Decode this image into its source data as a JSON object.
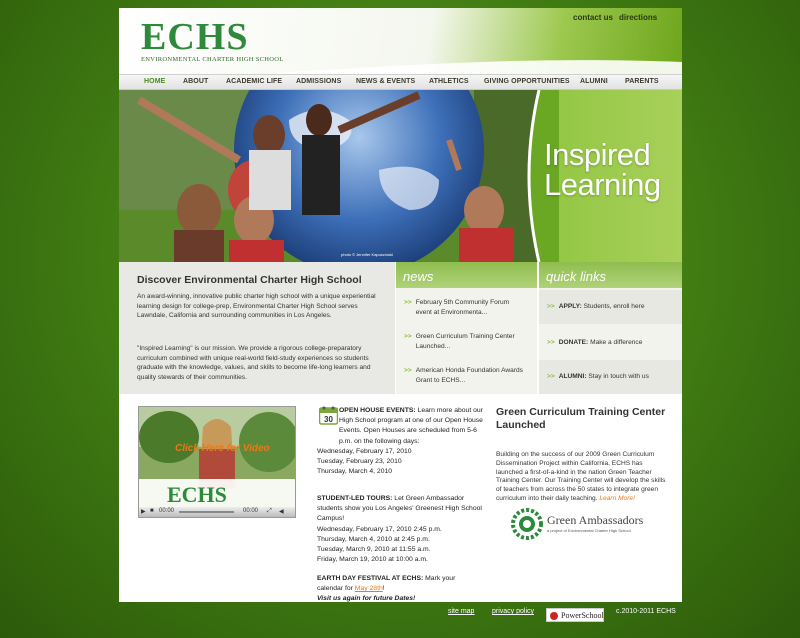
{
  "header": {
    "logo_text": "ECHS",
    "logo_sub": "ENVIRONMENTAL CHARTER HIGH SCHOOL",
    "util_links": [
      "contact us",
      "directions"
    ]
  },
  "nav": {
    "items": [
      "HOME",
      "ABOUT",
      "ACADEMIC LIFE",
      "ADMISSIONS",
      "NEWS & EVENTS",
      "ATHLETICS",
      "GIVING OPPORTUNITIES",
      "ALUMNI",
      "PARENTS"
    ],
    "active": "HOME"
  },
  "hero": {
    "line1": "Inspired",
    "line2": "Learning",
    "credit": "photo © Jennifer Kapuscinski"
  },
  "discover": {
    "title": "Discover Environmental Charter High School",
    "para1": "An award-winning, innovative public charter high school with a unique experiential learning design for college-prep, Environmental Charter High School serves Lawndale, California and surrounding communities in Los Angeles.",
    "para2": "\"Inspired Learning\" is our mission. We provide a rigorous college-preparatory curriculum combined with unique real-world field-study experiences so students graduate with the knowledge, values, and skills to become life-long learners and quality stewards of their communities."
  },
  "news": {
    "heading": "news",
    "items": [
      "February 5th Community Forum event at Environmenta...",
      "Green Curriculum Training Center Launched...",
      "American Honda Foundation Awards Grant to ECHS..."
    ]
  },
  "quick_links": {
    "heading": "quick links",
    "items": [
      {
        "label": "APPLY:",
        "text": "Students, enroll here"
      },
      {
        "label": "DONATE:",
        "text": "Make a difference"
      },
      {
        "label": "ALUMNI:",
        "text": "Stay in touch with us"
      }
    ]
  },
  "video": {
    "overlay": "Click Here for Video",
    "logo": "ECHS",
    "time_left": "00:00",
    "time_right": "00:00"
  },
  "events": {
    "calendar_day": "30",
    "open_house_label": "OPEN HOUSE EVENTS:",
    "open_house_text": "Learn more about our High School program at one of our Open House Events. Open Houses are scheduled from 5-6 p.m. on the following days:",
    "open_house_dates": [
      "Wednesday, February 17, 2010",
      "Tuesday, February 23, 2010",
      "Thursday, March 4, 2010"
    ],
    "tours_label": "STUDENT-LED TOURS:",
    "tours_text": "Let Green Ambassador students show you Los Angeles' Greenest High School Campus!",
    "tours_dates": [
      "Wednesday, February 17, 2010  2:45 p.m.",
      "Thursday, March 4, 2010 at 2:45 p.m.",
      "Tuesday, March 9, 2010 at 11:55 a.m.",
      "Friday, March 19, 2010 at 10:00 a.m."
    ],
    "earth_label": "EARTH DAY FESTIVAL AT ECHS:",
    "earth_text": "Mark your calendar for",
    "earth_link": "May 28th",
    "earth_end": "!",
    "visit": "Visit us again for future Dates!"
  },
  "gct": {
    "title": "Green Curriculum Training Center Launched",
    "body": "Building on the success of our 2009 Green Curriculum Dissemination Project within California, ECHS has launched a first-of-a-kind in the nation Green Teacher Training Center. Our Training Center will develop the skills of teachers from across the 50 states to integrate green curriculum into their daily teaching.",
    "more": "Learn More!",
    "ga_name": "Green Ambassadors",
    "ga_tag": "a project of Environmental Charter High School"
  },
  "footer": {
    "site_map": "site map",
    "privacy": "privacy policy",
    "powerschool": "PowerSchool",
    "copyright": "c.2010-2011 ECHS"
  },
  "colors": {
    "brand_green": "#2d8a3a",
    "accent_orange": "#e87a1a",
    "background_green": "#3f7a12"
  }
}
